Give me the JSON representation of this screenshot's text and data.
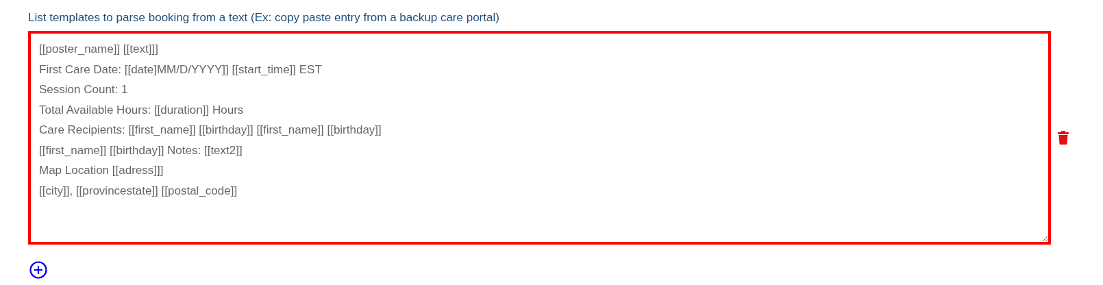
{
  "label": "List templates to parse booking from a text (Ex: copy paste entry from a backup care portal)",
  "templates": [
    {
      "value": "[[poster_name]] [[text]]]\nFirst Care Date: [[date]MM/D/YYYY]] [[start_time]] EST\nSession Count: 1\nTotal Available Hours: [[duration]] Hours\nCare Recipients: [[first_name]] [[birthday]] [[first_name]] [[birthday]]\n[[first_name]] [[birthday]] Notes: [[text2]]\nMap Location [[adress]]]\n[[city]], [[provincestate]] [[postal_code]]"
    }
  ]
}
